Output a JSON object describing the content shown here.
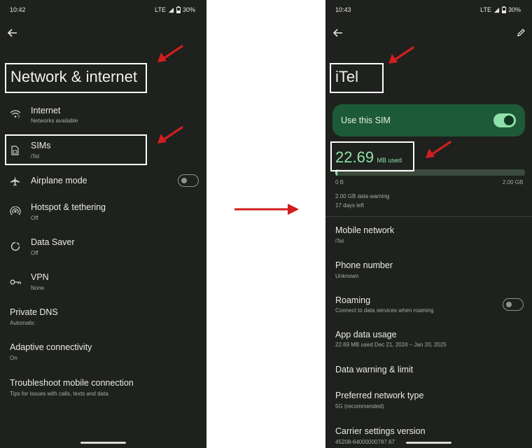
{
  "left": {
    "status": {
      "time": "10:42",
      "network": "LTE",
      "battery": "30%"
    },
    "title": "Network & internet",
    "items": [
      {
        "label": "Internet",
        "sub": "Networks available",
        "icon": "wifi-question-icon"
      },
      {
        "label": "SIMs",
        "sub": "iTel",
        "icon": "sim-card-icon"
      },
      {
        "label": "Airplane mode",
        "icon": "airplane-icon"
      },
      {
        "label": "Hotspot & tethering",
        "sub": "Off",
        "icon": "hotspot-icon"
      },
      {
        "label": "Data Saver",
        "sub": "Off",
        "icon": "data-saver-icon"
      },
      {
        "label": "VPN",
        "sub": "None",
        "icon": "vpn-key-icon"
      },
      {
        "label": "Private DNS",
        "sub": "Automatic"
      },
      {
        "label": "Adaptive connectivity",
        "sub": "On"
      },
      {
        "label": "Troubleshoot mobile connection",
        "sub": "Tips for issues with calls, texts and data"
      }
    ],
    "airplane_mode_on": false
  },
  "right": {
    "status": {
      "time": "10:43",
      "network": "LTE",
      "battery": "30%"
    },
    "title": "iTel",
    "use_sim": {
      "label": "Use this SIM",
      "on": true
    },
    "usage": {
      "amount": "22.69",
      "unit": "MB used",
      "range_start": "0 B",
      "range_end": "2.00 GB",
      "fill_fraction": 0.011,
      "warning": "2.00 GB data warning",
      "days_left": "17 days left"
    },
    "items": [
      {
        "label": "Mobile network",
        "sub": "iTel"
      },
      {
        "label": "Phone number",
        "sub": "Unknown"
      },
      {
        "label": "Roaming",
        "sub": "Connect to data services when roaming"
      },
      {
        "label": "App data usage",
        "sub": "22.69 MB used Dec 21, 2024 – Jan 20, 2025"
      },
      {
        "label": "Data warning & limit"
      },
      {
        "label": "Preferred network type",
        "sub": "5G (recommended)"
      },
      {
        "label": "Carrier settings version",
        "sub": "45208-64000000787.67"
      }
    ],
    "roaming_on": false
  },
  "colors": {
    "background": "#1e211d",
    "sim_card": "#1d5a37",
    "accent": "#8ee0a8",
    "annotation_red": "#d21e1e"
  }
}
